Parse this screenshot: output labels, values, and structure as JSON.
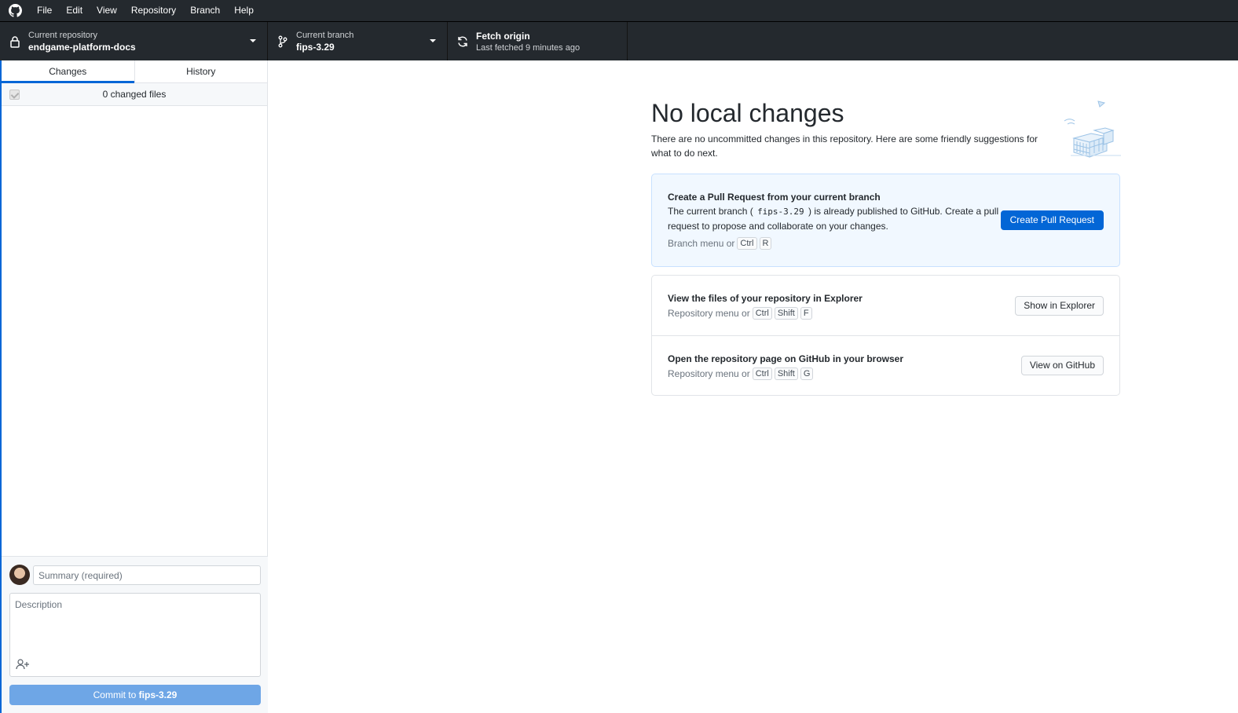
{
  "menubar": {
    "items": [
      "File",
      "Edit",
      "View",
      "Repository",
      "Branch",
      "Help"
    ]
  },
  "toolbar": {
    "repo_label": "Current repository",
    "repo_value": "endgame-platform-docs",
    "branch_label": "Current branch",
    "branch_value": "fips-3.29",
    "fetch_title": "Fetch origin",
    "fetch_subtitle": "Last fetched 9 minutes ago"
  },
  "sidebar": {
    "tabs": [
      "Changes",
      "History"
    ],
    "active_tab": "Changes",
    "changed_files_label": "0 changed files",
    "summary_placeholder": "Summary (required)",
    "description_placeholder": "Description",
    "commit_prefix": "Commit to ",
    "commit_branch": "fips-3.29"
  },
  "main": {
    "title": "No local changes",
    "lead": "There are no uncommitted changes in this repository. Here are some friendly suggestions for what to do next.",
    "pull_request": {
      "title": "Create a Pull Request from your current branch",
      "desc_before": "The current branch ( ",
      "desc_branch": "fips-3.29",
      "desc_after": " ) is already published to GitHub. Create a pull request to propose and collaborate on your changes.",
      "hint_prefix": "Branch menu or",
      "keys": [
        "Ctrl",
        "R"
      ],
      "button": "Create Pull Request"
    },
    "explorer": {
      "title": "View the files of your repository in Explorer",
      "hint_prefix": "Repository menu or",
      "keys": [
        "Ctrl",
        "Shift",
        "F"
      ],
      "button": "Show in Explorer"
    },
    "github": {
      "title": "Open the repository page on GitHub in your browser",
      "hint_prefix": "Repository menu or",
      "keys": [
        "Ctrl",
        "Shift",
        "G"
      ],
      "button": "View on GitHub"
    }
  },
  "colors": {
    "toolbar_bg": "#24292e",
    "accent": "#0366d6",
    "commit_button_disabled": "#6ea6e6",
    "primary_card_bg": "#f1f8ff"
  }
}
